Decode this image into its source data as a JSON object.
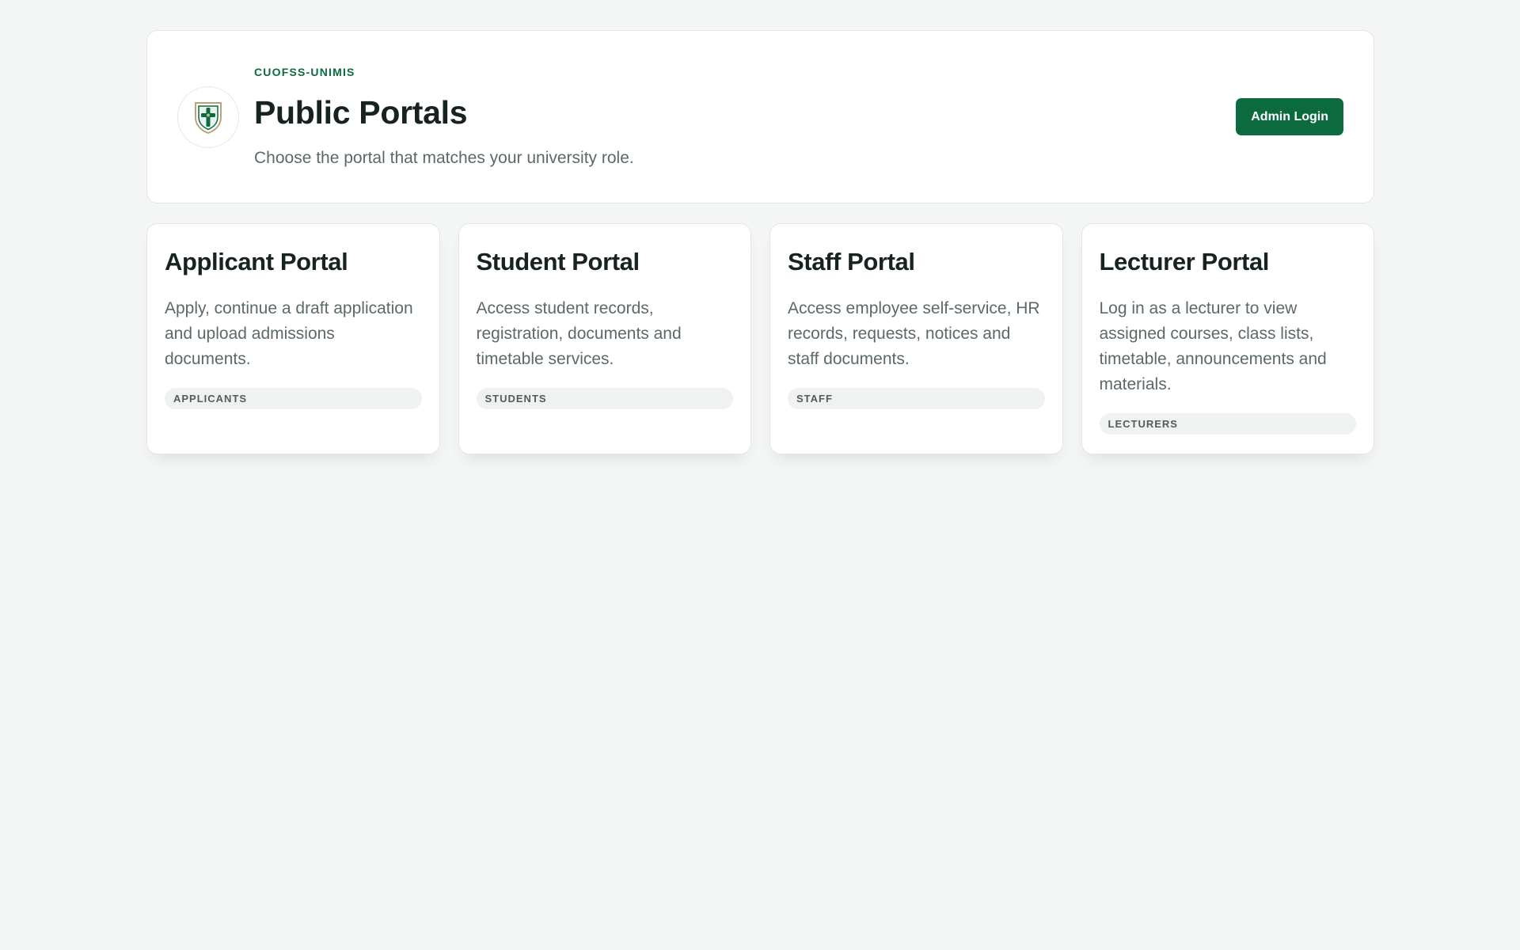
{
  "header": {
    "eyebrow": "CUOFSS-UNIMIS",
    "title": "Public Portals",
    "subtitle": "Choose the portal that matches your university role.",
    "logo_icon": "university-crest-icon",
    "admin_button_label": "Admin Login"
  },
  "portals": [
    {
      "title": "Applicant Portal",
      "description": "Apply, continue a draft application and upload admissions documents.",
      "badge": "APPLICANTS"
    },
    {
      "title": "Student Portal",
      "description": "Access student records, registration, documents and timetable services.",
      "badge": "STUDENTS"
    },
    {
      "title": "Staff Portal",
      "description": "Access employee self-service, HR records, requests, notices and staff documents.",
      "badge": "STAFF"
    },
    {
      "title": "Lecturer Portal",
      "description": "Log in as a lecturer to view assigned courses, class lists, timetable, announcements and materials.",
      "badge": "LECTURERS"
    }
  ],
  "colors": {
    "brand": "#0b6b3f",
    "page_background": "#f4f6f5",
    "card_background": "#ffffff",
    "muted_text": "#5b6b63"
  }
}
